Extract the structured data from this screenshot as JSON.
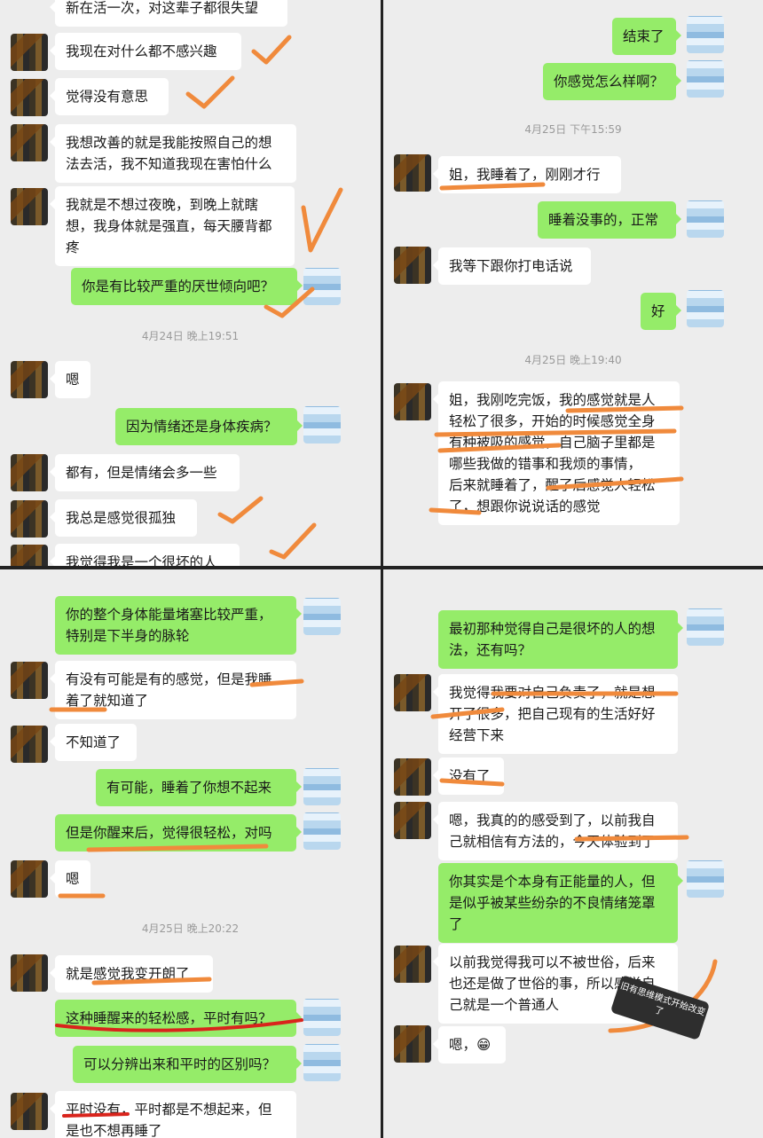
{
  "panel1": {
    "top_text": "新在活一次，对这辈子都很失望",
    "messages": [
      "我现在对什么都不感兴趣",
      "觉得没有意思",
      "我想改善的就是我能按照自己的想\n法去活，我不知道我现在害怕什么",
      "我就是不想过夜晚，到晚上就瞎\n想，我身体就是强直，每天腰背都\n疼",
      "你是有比较严重的厌世倾向吧？",
      "嗯",
      "因为情绪还是身体疾病？",
      "都有，但是情绪会多一些",
      "我总是感觉很孤独",
      "我觉得我是一个很坏的人"
    ],
    "timestamp": "4月24日 晚上19:51"
  },
  "panel2": {
    "messages": [
      "结束了",
      "你感觉怎么样啊？",
      "姐，我睡着了，刚刚才行",
      "睡着没事的，正常",
      "我等下跟你打电话说",
      "好",
      "姐，我刚吃完饭，我的感觉就是人\n轻松了很多，开始的时候感觉全身\n有种被吸的感觉，自己脑子里都是\n哪些我做的错事和我烦的事情，\n后来就睡着了，醒了后感觉人轻松\n了，想跟你说说话的感觉"
    ],
    "timestamp1": "4月25日 下午15:59",
    "timestamp2": "4月25日 晚上19:40"
  },
  "panel3": {
    "messages": [
      "你的整个身体能量堵塞比较严重，\n特别是下半身的脉轮",
      "有没有可能是有的感觉，但是我睡\n着了就知道了",
      "不知道了",
      "有可能，睡着了你想不起来",
      "但是你醒来后，觉得很轻松，对吗",
      "嗯",
      "就是感觉我变开朗了",
      "这种睡醒来的轻松感，平时有吗？",
      "可以分辨出来和平时的区别吗？",
      "平时没有，平时都是不想起来，但\n是也不想再睡了"
    ],
    "timestamp": "4月25日 晚上20:22"
  },
  "panel4": {
    "messages": [
      "最初那种觉得自己是很坏的人的想\n法，还有吗？",
      "我觉得我要对自己负责了，就是想\n开了很多，把自己现有的生活好好\n经营下来",
      "没有了",
      "嗯，我真的的感受到了，以前我自\n己就相信有方法的，今天体验到了",
      "你其实是个本身有正能量的人，但\n是似乎被某些纷杂的不良情绪笼罩\n了",
      "以前我觉得我可以不被世俗，后来\n也还是做了世俗的事，所以感觉自\n己就是一个普通人",
      "嗯，😁"
    ],
    "annotation_note": "旧有思维模式开始改变了"
  },
  "colors": {
    "ink_orange": "#f08a3c",
    "ink_red": "#d9241c",
    "bubble_green": "#95ec69"
  }
}
